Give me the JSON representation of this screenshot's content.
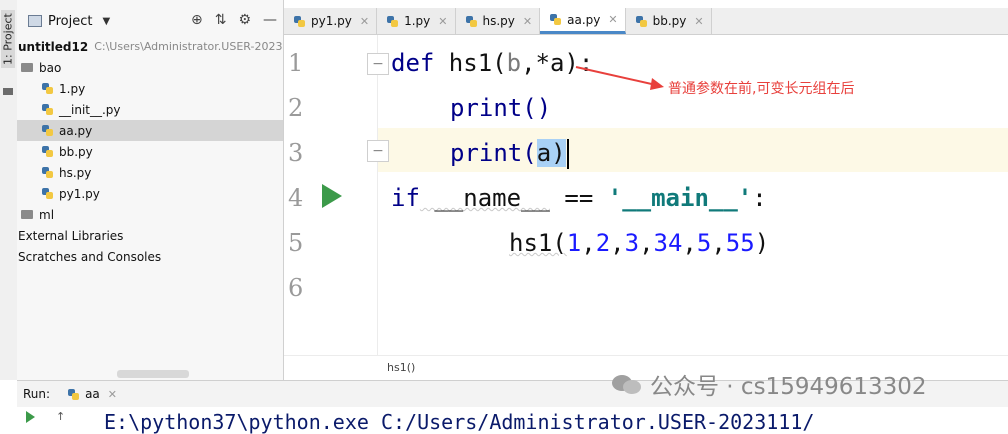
{
  "sidebar": {
    "vertical_label": "1: Project"
  },
  "project_panel": {
    "title": "Project",
    "tree": [
      {
        "label": "untitled12",
        "path": "C:\\Users\\Administrator.USER-2023"
      },
      {
        "label": "bao"
      },
      {
        "label": "1.py"
      },
      {
        "label": "__init__.py"
      },
      {
        "label": "aa.py"
      },
      {
        "label": "bb.py"
      },
      {
        "label": "hs.py"
      },
      {
        "label": "py1.py"
      },
      {
        "label": "ml"
      },
      {
        "label": "External Libraries"
      },
      {
        "label": "Scratches and Consoles"
      }
    ]
  },
  "tabs": [
    {
      "label": "py1.py"
    },
    {
      "label": "1.py"
    },
    {
      "label": "hs.py"
    },
    {
      "label": "aa.py"
    },
    {
      "label": "bb.py"
    }
  ],
  "editor": {
    "line_numbers": [
      "1",
      "2",
      "3",
      "4",
      "5",
      "6"
    ],
    "line1": {
      "kw": "def",
      "name": " hs1(",
      "param_b": "b",
      "rest": ",*a):"
    },
    "line2": {
      "text": "print()"
    },
    "line3": {
      "func": "print(",
      "arg": "a",
      "close": ")"
    },
    "line4": {
      "kw": "if",
      "name": " __name__",
      "op": " == ",
      "str": "'__main__'",
      "colon": ":"
    },
    "line5": {
      "call": "hs1(",
      "args": [
        "1",
        "2",
        "3",
        "34",
        "5",
        "55"
      ],
      "close": ")"
    },
    "annotation": "普通参数在前,可变长元组在后",
    "breadcrumb": "hs1()"
  },
  "run_panel": {
    "label": "Run:",
    "tab": "aa",
    "console_text": "E:\\python37\\python.exe C:/Users/Administrator.USER-2023111/"
  },
  "watermark": "公众号 · cs15949613302",
  "colors": {
    "accent": "#4a88c7",
    "keyword": "#000088",
    "number": "#1a1aff",
    "string": "#107a7a",
    "annotation": "#e8403c"
  }
}
